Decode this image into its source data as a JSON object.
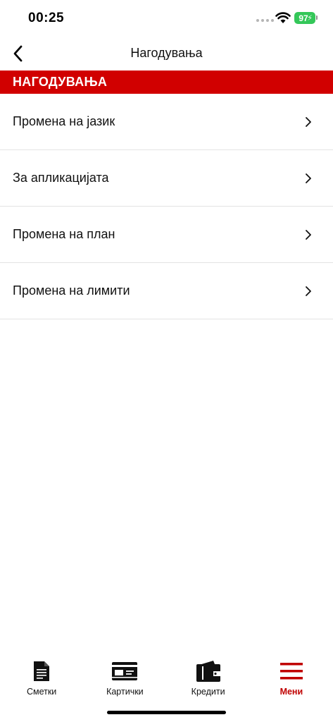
{
  "status_bar": {
    "time": "00:25",
    "battery": "97"
  },
  "nav": {
    "title": "Нагодувања"
  },
  "section": {
    "header": "НАГОДУВАЊА"
  },
  "menu": {
    "items": [
      {
        "label": "Промена на јазик"
      },
      {
        "label": "За апликацијата"
      },
      {
        "label": "Промена на план"
      },
      {
        "label": "Промена на лимити"
      }
    ]
  },
  "tabs": [
    {
      "label": "Сметки",
      "icon": "document-icon"
    },
    {
      "label": "Картички",
      "icon": "card-icon"
    },
    {
      "label": "Кредити",
      "icon": "wallet-icon"
    },
    {
      "label": "Мени",
      "icon": "hamburger-menu-icon",
      "active": true
    }
  ],
  "colors": {
    "accent": "#d10000",
    "battery": "#34c759"
  }
}
